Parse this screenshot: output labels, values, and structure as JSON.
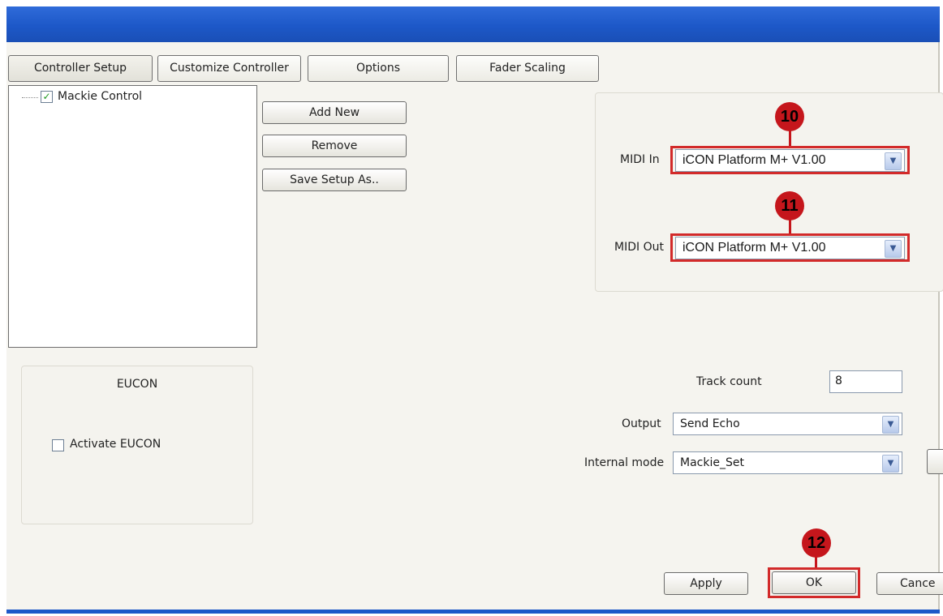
{
  "tabs": [
    {
      "label": "Controller Setup"
    },
    {
      "label": "Customize Controller"
    },
    {
      "label": "Options"
    },
    {
      "label": "Fader Scaling"
    }
  ],
  "controller_list": {
    "items": [
      {
        "label": "Mackie Control",
        "checked": true
      }
    ]
  },
  "buttons": {
    "add_new": "Add New",
    "remove": "Remove",
    "save_setup_as": "Save Setup As..",
    "apply": "Apply",
    "ok": "OK",
    "cancel": "Cance"
  },
  "midi": {
    "in_label": "MIDI In",
    "in_value": "iCON Platform M+ V1.00",
    "out_label": "MIDI Out",
    "out_value": "iCON Platform M+ V1.00"
  },
  "eucon": {
    "title": "EUCON",
    "activate_label": "Activate EUCON",
    "activate_checked": false
  },
  "settings": {
    "track_count_label": "Track count",
    "track_count_value": "8",
    "output_label": "Output",
    "output_value": "Send Echo",
    "internal_mode_label": "Internal mode",
    "internal_mode_value": "Mackie_Set"
  },
  "callouts": {
    "midi_in": "10",
    "midi_out": "11",
    "ok": "12"
  },
  "colors": {
    "titlebar": "#1d58c8",
    "callout": "#c5161c",
    "highlight_border": "#d22a2a"
  }
}
